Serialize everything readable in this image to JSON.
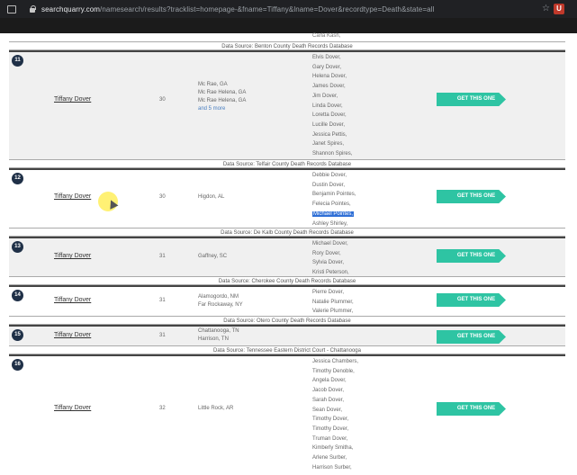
{
  "browser": {
    "url_host": "searchquarry.com",
    "url_path": "/namesearch/results?tracklist=homepage-&fname=Tiffany&lname=Dover&recordtype=Death&state=all"
  },
  "action_label": "GET THIS ONE",
  "first_relative": "Carla Kash,",
  "results": [
    {
      "number": "11",
      "name": "Tiffany Dover",
      "age": "30",
      "locations": [
        "Mc Rae, GA",
        "Mc Rae Helena, GA",
        "Mc Rae Helena, GA"
      ],
      "more": "and 5 more",
      "relatives": [
        "Elvis Dover,",
        "Gary Dover,",
        "Helena Dover,",
        "James Dover,",
        "Jim Dover,",
        "Linda Dover,",
        "Loretta Dover,",
        "Lucille Dover,",
        "Jessica Pettis,",
        "Janet Spires,",
        "Shannon Spires,"
      ],
      "source": "Data Source: Telfair County Death Records Database"
    },
    {
      "number": "12",
      "name": "Tiffany Dover",
      "age": "30",
      "locations": [
        "Higdon, AL"
      ],
      "relatives": [
        "Debbie Dover,",
        "Dustin Dover,",
        "Benjamin Pointes,",
        "Felecia Pointes,",
        "Michael Pointes,",
        "Ashley Shirley,"
      ],
      "highlight": "Michael Pointes,",
      "source": "Data Source: De Kalb County Death Records Database"
    },
    {
      "number": "13",
      "name": "Tiffany Dover",
      "age": "31",
      "locations": [
        "Gaffney, SC"
      ],
      "relatives": [
        "Michael Dover,",
        "Rory Dover,",
        "Sylvia Dover,",
        "Kristi Peterson,"
      ],
      "source": "Data Source: Cherokee County Death Records Database"
    },
    {
      "number": "14",
      "name": "Tiffany Dover",
      "age": "31",
      "locations": [
        "Alamogordo, NM",
        "Far Rockaway, NY"
      ],
      "relatives": [
        "Pierre Dover,",
        "Natalie Plummer,",
        "Valerie Plummer,"
      ],
      "source": "Data Source: Otero County Death Records Database"
    },
    {
      "number": "15",
      "name": "Tiffany Dover",
      "age": "31",
      "locations": [
        "Chattanooga, TN",
        "Harrison, TN"
      ],
      "relatives": [],
      "source": "Data Source: Tennessee Eastern District Court - Chattanooga"
    },
    {
      "number": "16",
      "name": "Tiffany Dover",
      "age": "32",
      "locations": [
        "Little Rock, AR"
      ],
      "relatives": [
        "Jessica Chambers,",
        "Timothy Denoble,",
        "Angela Dover,",
        "Jacob Dover,",
        "Sarah Dover,",
        "Sean Dover,",
        "Timothy Dover,",
        "Timothy Dover,",
        "Truman Dover,",
        "Kimberly Smitha,",
        "Arlene Surber,",
        "Harrison Surber,"
      ]
    }
  ],
  "sources_above": {
    "first": "Data Source: Benton County Death Records Database"
  }
}
